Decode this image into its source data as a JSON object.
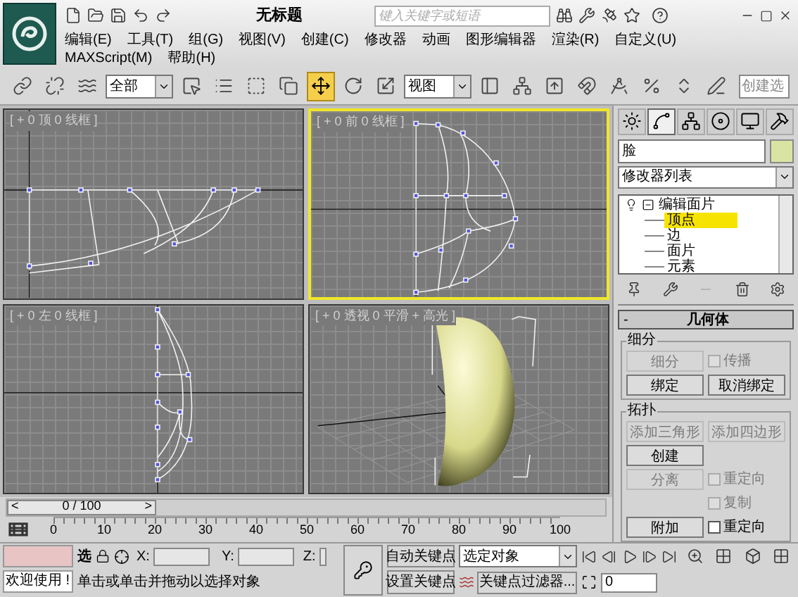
{
  "title_bar": {
    "title": "无标题",
    "search": {
      "placeholder": "键入关键字或短语"
    }
  },
  "menu": [
    "编辑(E)",
    "工具(T)",
    "组(G)",
    "视图(V)",
    "创建(C)",
    "修改器",
    "动画",
    "图形编辑器",
    "渲染(R)",
    "自定义(U)",
    "MAXScript(M)",
    "帮助(H)"
  ],
  "toolbar": [
    {
      "kind": "tool",
      "selected": false
    },
    {
      "kind": "tool",
      "selected": false
    },
    {
      "kind": "tool",
      "selected": false
    },
    {
      "kind": "dropdown",
      "value": "全部"
    },
    {
      "kind": "tool",
      "selected": false
    },
    {
      "kind": "tool",
      "selected": false
    },
    {
      "kind": "tool",
      "selected": false
    },
    {
      "kind": "tool",
      "selected": false
    },
    {
      "kind": "tool",
      "selected": true
    },
    {
      "kind": "tool",
      "selected": false
    },
    {
      "kind": "tool",
      "selected": false
    },
    {
      "kind": "dropdown",
      "value": "视图"
    },
    {
      "kind": "tool",
      "selected": false
    },
    {
      "kind": "tool",
      "selected": false
    },
    {
      "kind": "tool",
      "selected": false
    },
    {
      "kind": "tool",
      "selected": false
    },
    {
      "kind": "tool",
      "selected": false
    },
    {
      "kind": "tool",
      "selected": false
    },
    {
      "kind": "tool",
      "selected": false
    },
    {
      "kind": "tool",
      "selected": false
    },
    {
      "kind": "field",
      "placeholder": "创建选"
    }
  ],
  "viewports": [
    {
      "label": "[ + 0 顶 0 线框 ]",
      "kind": "top",
      "active": false
    },
    {
      "label": "[ + 0 前 0 线框 ]",
      "kind": "front",
      "active": true
    },
    {
      "label": "[ + 0 左 0 线框 ]",
      "kind": "left",
      "active": false
    },
    {
      "label": "[ + 0 透视 0 平滑 + 高光 ]",
      "kind": "perspective",
      "active": false
    }
  ],
  "time_slider": {
    "prev": "<",
    "position": "0 / 100",
    "next": ">",
    "level": 0
  },
  "ruler": [
    "0",
    "10",
    "20",
    "30",
    "40",
    "50",
    "60",
    "70",
    "80",
    "90",
    "100"
  ],
  "command_panel": {
    "tabs": [
      {
        "selected": false
      },
      {
        "selected": true
      },
      {
        "selected": false
      },
      {
        "selected": false
      },
      {
        "selected": false
      },
      {
        "selected": false
      }
    ],
    "object_name": "脸",
    "modifier_list": "修改器列表",
    "stack": [
      {
        "label": "编辑面片",
        "expanded": true,
        "children": [
          {
            "label": "顶点",
            "selected": true
          },
          {
            "label": "边",
            "selected": false
          },
          {
            "label": "面片",
            "selected": false
          },
          {
            "label": "元素",
            "selected": false
          }
        ]
      }
    ],
    "rollout": {
      "collapse": "-",
      "title": "几何体",
      "groups": [
        {
          "title": "细分",
          "rows": [
            [
              {
                "kind": "button",
                "label": "细分",
                "disabled": true
              },
              {
                "kind": "checkbox",
                "label": "传播",
                "checked": false,
                "disabled": true
              }
            ],
            [
              {
                "kind": "button",
                "label": "绑定",
                "disabled": false
              },
              {
                "kind": "button",
                "label": "取消绑定",
                "disabled": false
              }
            ]
          ]
        },
        {
          "title": "拓扑",
          "rows": [
            [
              {
                "kind": "button",
                "label": "添加三角形",
                "disabled": true
              },
              {
                "kind": "button",
                "label": "添加四边形",
                "disabled": true
              }
            ],
            [
              {
                "kind": "button",
                "label": "创建",
                "disabled": false
              }
            ],
            [
              {
                "kind": "button",
                "label": "分离",
                "disabled": true
              },
              {
                "kind": "checkbox",
                "label": "重定向",
                "checked": false,
                "disabled": true
              }
            ],
            [
              "",
              {
                "kind": "checkbox",
                "label": "复制",
                "checked": false,
                "disabled": true
              }
            ],
            [
              {
                "kind": "button",
                "label": "附加",
                "disabled": false
              },
              {
                "kind": "checkbox",
                "label": "重定向",
                "checked": false,
                "disabled": false
              }
            ]
          ]
        }
      ]
    }
  },
  "status": {
    "lock_label": "选",
    "x_label": "X:",
    "y_label": "Y:",
    "z_label": "Z:",
    "welcome": "欢迎使用 !",
    "prompt": "单击或单击并拖动以选择对象",
    "auto_key": "自动关键点",
    "set_key": "设置关键点",
    "key_mode": "选定对象",
    "key_filters": "关键点过滤器...",
    "current_frame": "0"
  }
}
